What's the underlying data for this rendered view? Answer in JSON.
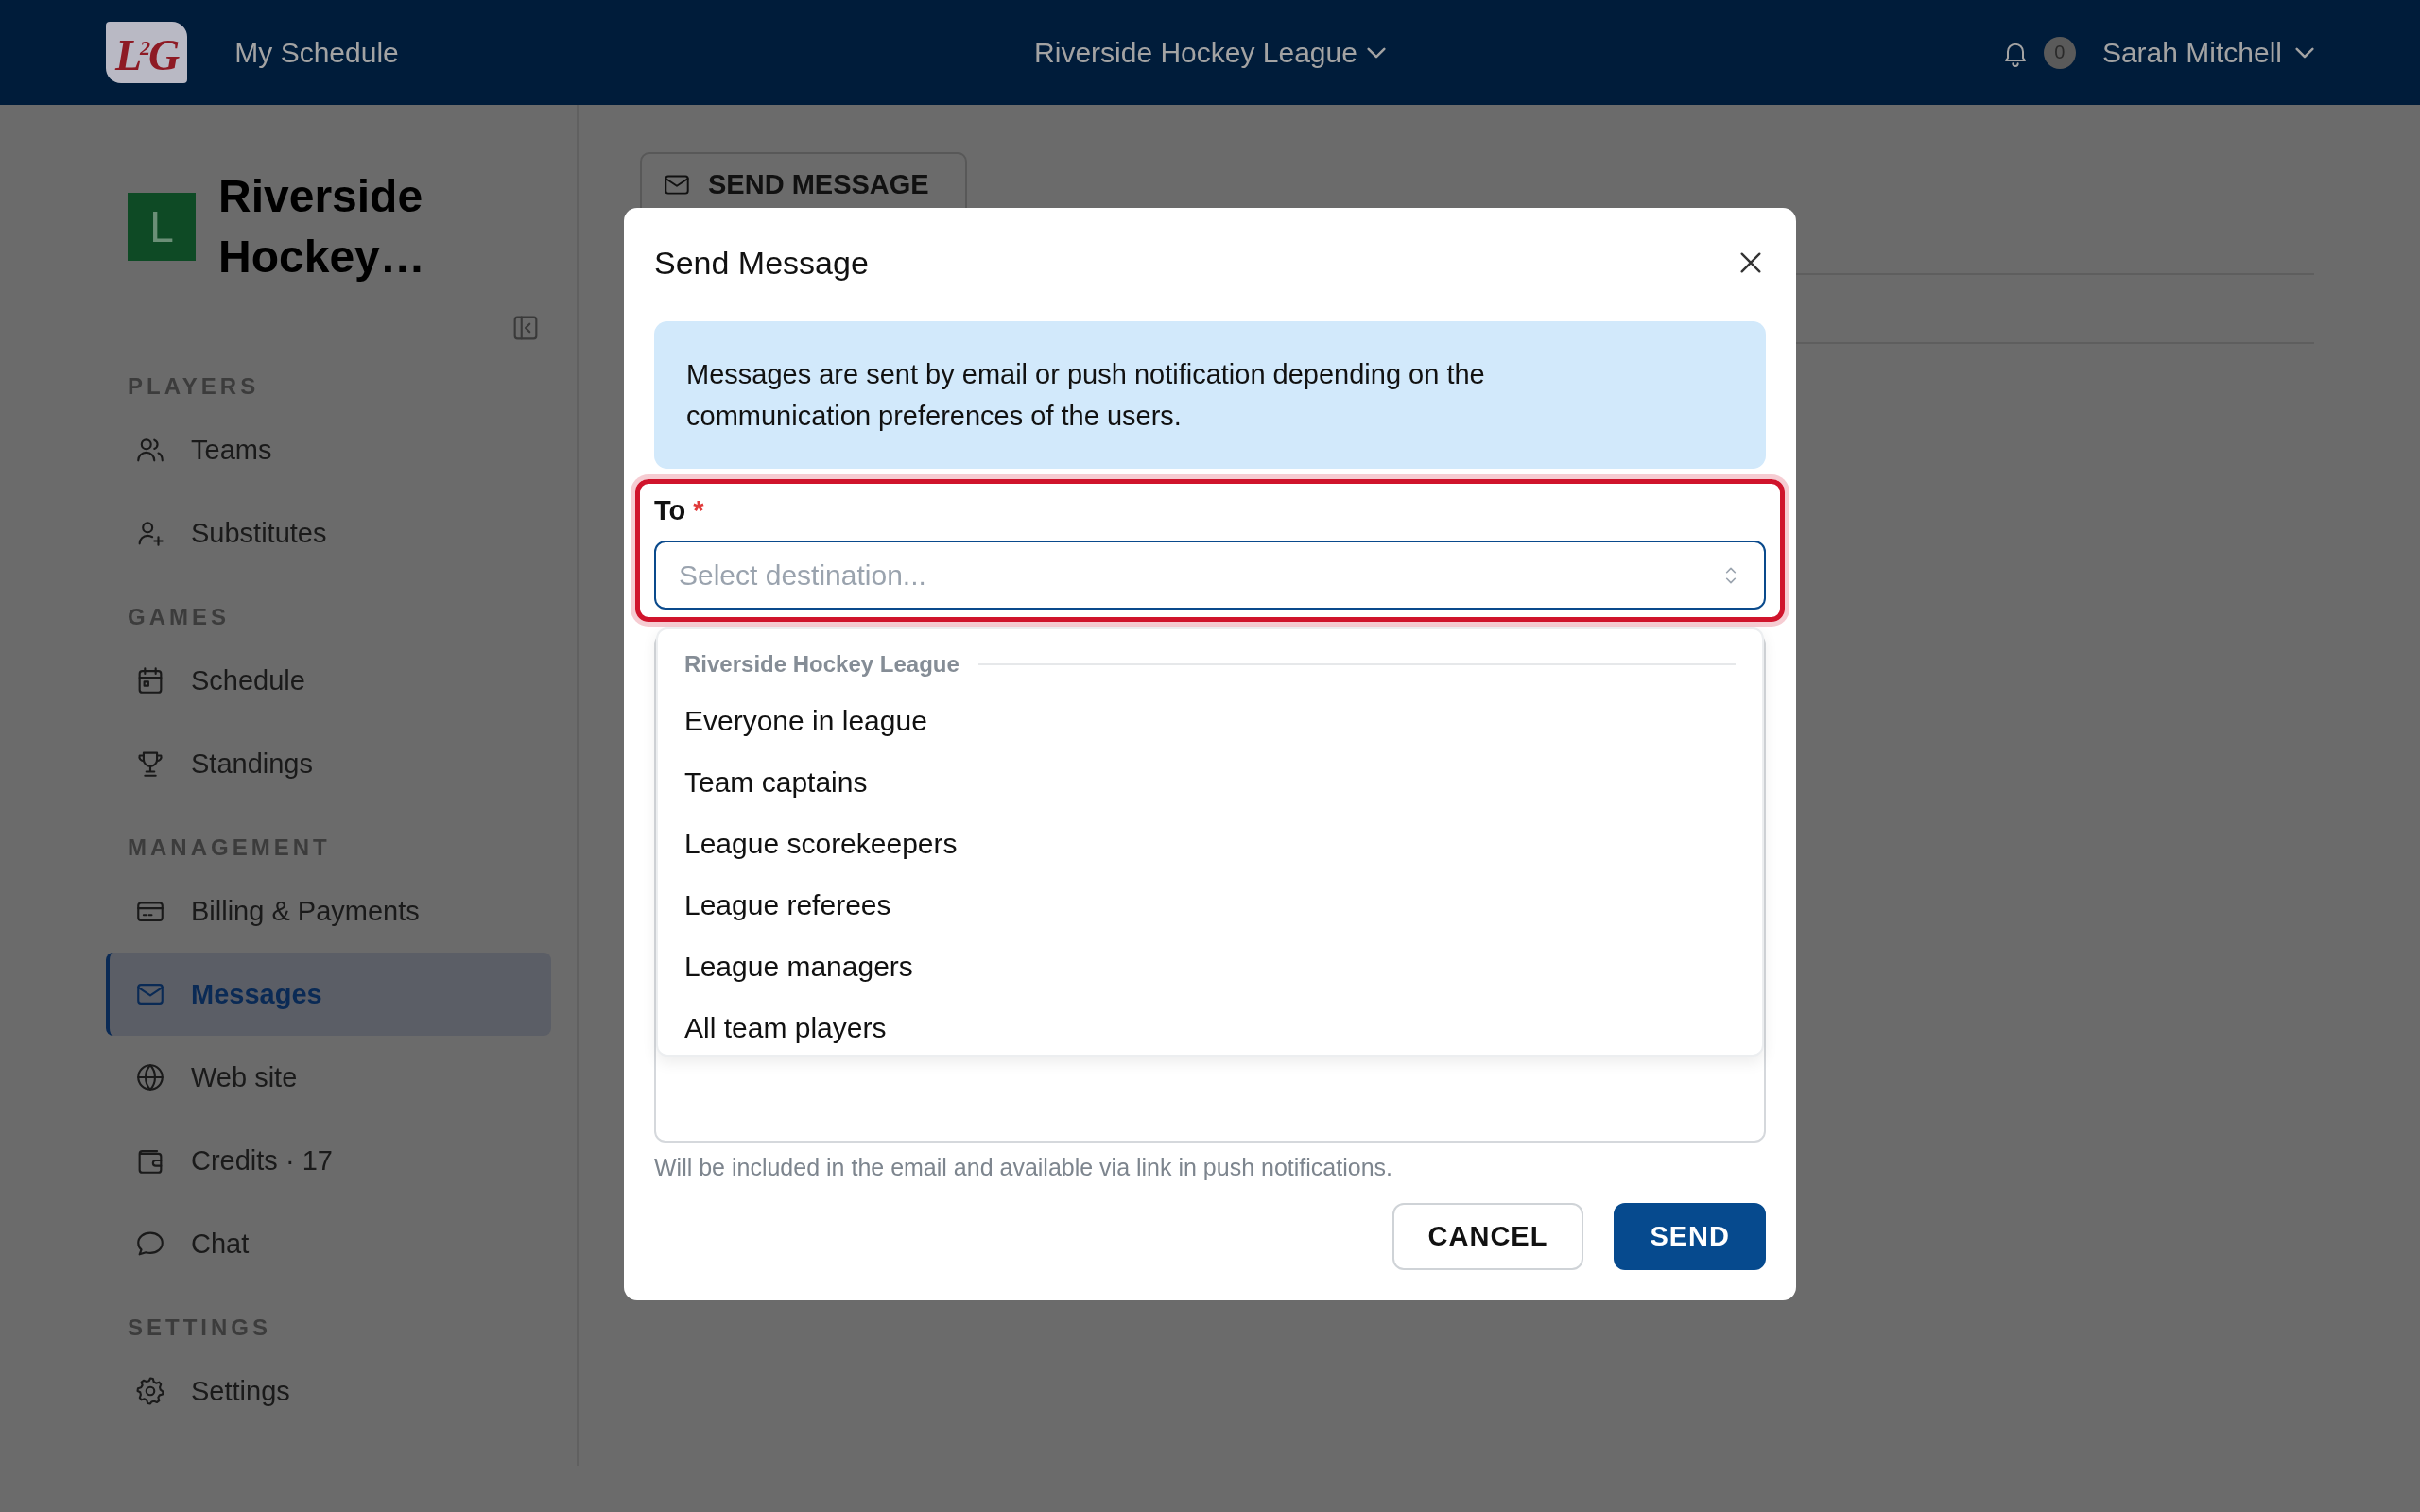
{
  "top_bar": {
    "logo_text": "L$^{2}$G",
    "nav_link": "My Schedule",
    "league_menu": "Riverside Hockey League",
    "notification_count": "0",
    "user_menu": "Sarah Mitchell"
  },
  "sidebar": {
    "logo_letter": "L",
    "title": "Riverside Hockey…",
    "sections": [
      {
        "heading": "PLAYERS",
        "items": [
          {
            "label": "Teams",
            "selected": false
          },
          {
            "label": "Substitutes",
            "selected": false
          }
        ]
      },
      {
        "heading": "GAMES",
        "items": [
          {
            "label": "Schedule",
            "selected": false
          },
          {
            "label": "Standings",
            "selected": false
          }
        ]
      },
      {
        "heading": "MANAGEMENT",
        "items": [
          {
            "label": "Billing & Payments",
            "selected": false
          },
          {
            "label": "Messages",
            "selected": true
          },
          {
            "label": "Web site",
            "selected": false
          },
          {
            "label": "Credits · 17",
            "selected": false
          },
          {
            "label": "Chat",
            "selected": false
          }
        ]
      },
      {
        "heading": "SETTINGS",
        "items": [
          {
            "label": "Settings",
            "selected": false
          }
        ]
      }
    ]
  },
  "page": {
    "send_message_button": "SEND MESSAGE"
  },
  "dialog": {
    "title": "Send Message",
    "info": "Messages are sent by email or push notification depending on the communication preferences of the users.",
    "to_field": {
      "label": "To",
      "required_mark": "*",
      "placeholder": "Select destination...",
      "invalid": true
    },
    "dropdown": {
      "group": "Riverside Hockey League",
      "options": [
        "Everyone in league",
        "Team captains",
        "League scorekeepers",
        "League referees",
        "League managers",
        "All team players"
      ]
    },
    "message_hint": "Will be included in the email and available via link in push notifications.",
    "buttons": [
      {
        "label": "CANCEL",
        "kind": "secondary"
      },
      {
        "label": "SEND",
        "kind": "primary"
      }
    ]
  }
}
